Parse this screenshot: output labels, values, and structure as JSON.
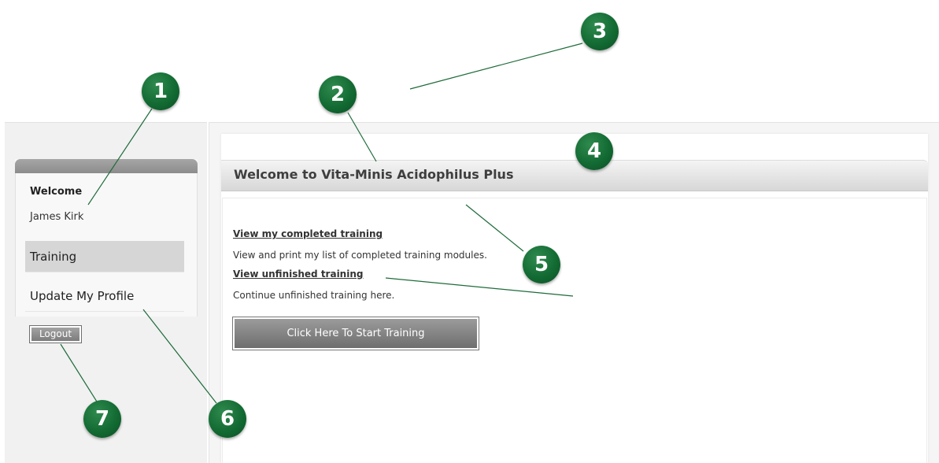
{
  "sidebar": {
    "welcome_label": "Welcome",
    "user_name": "James Kirk",
    "nav": {
      "training": "Training",
      "update_profile": "Update My Profile"
    },
    "logout_label": "Logout"
  },
  "main": {
    "title": "Welcome to Vita-Minis Acidophilus Plus",
    "completed_link": "View my completed training",
    "completed_desc": "View and print my list of completed training modules.",
    "unfinished_link": "View unfinished training",
    "unfinished_desc": "Continue unfinished training here.",
    "start_button": "Click Here To Start Training"
  },
  "callouts": [
    "1",
    "2",
    "3",
    "4",
    "5",
    "6",
    "7"
  ],
  "colors": {
    "callout_green": "#136b33",
    "button_gray": "#7c7c7c",
    "active_nav": "#d6d6d6"
  }
}
